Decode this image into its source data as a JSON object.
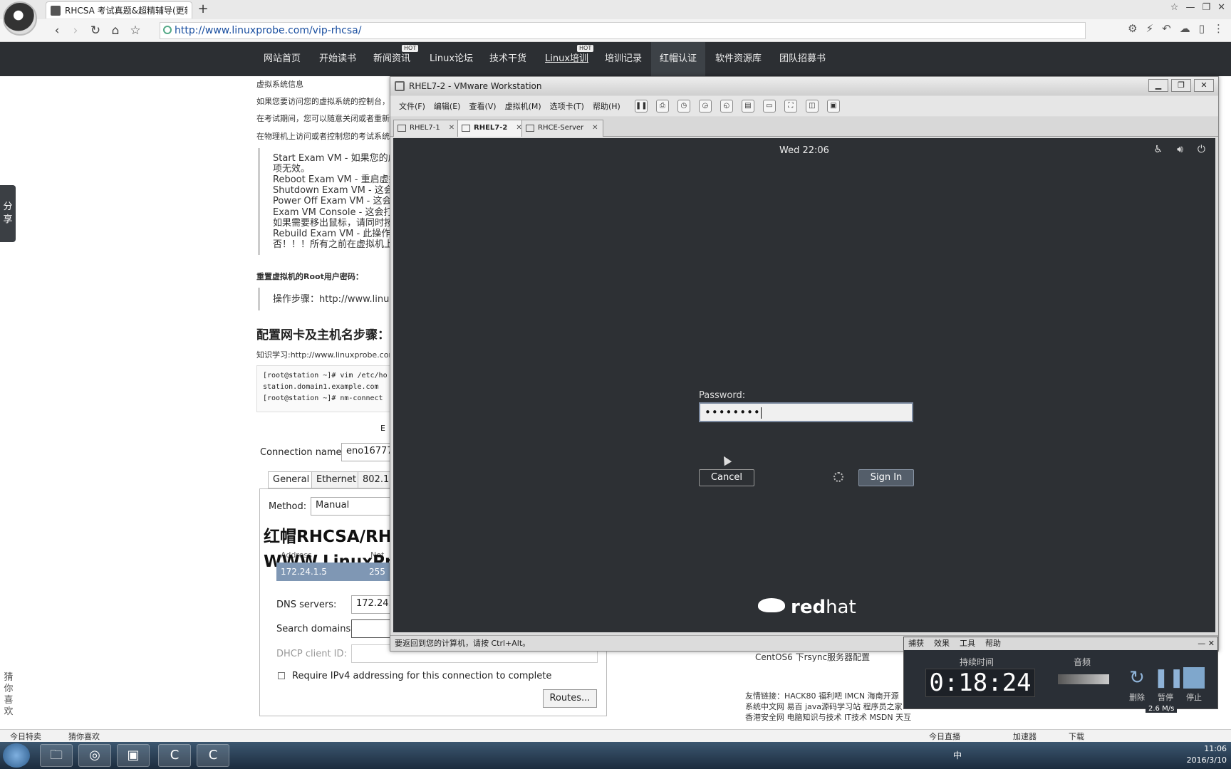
{
  "browser": {
    "tab_title": "RHCSA 考试真题&超精辅导(更新",
    "new_tab": "+",
    "url": "http://www.linuxprobe.com/vip-rhcsa/",
    "window_controls": [
      "☆",
      "—",
      "❐",
      "✕"
    ],
    "right_tools": [
      "⚙",
      "⚡",
      "↶",
      "☁",
      "▯",
      "⋮"
    ]
  },
  "site_nav": {
    "items": [
      "网站首页",
      "开始读书",
      "新闻资讯",
      "Linux论坛",
      "技术干货",
      "Linux培训",
      "培训记录",
      "红帽认证",
      "软件资源库",
      "团队招募书"
    ],
    "hot_badge": "HOT",
    "active": "红帽认证"
  },
  "page": {
    "share_label": "分享",
    "guess_label": "猜你喜欢",
    "section_title_small": "虚拟系统信息",
    "lines": [
      "如果您要访问您的虚拟系统的控制台，",
      "在考试期间，您可以随意关闭或者重新",
      "在物理机上访问或者控制您的考试系统"
    ],
    "quote_lines": [
      "Start Exam VM - 如果您的虚",
      "项无效。",
      "Reboot Exam VM - 重启虚拟",
      "Shutdown Exam VM - 这会",
      "Power Off Exam VM - 这会",
      "Exam VM Console - 这会打开",
      "如果需要移出鼠标，请同时按",
      "Rebuild Exam VM - 此操作将",
      "否！！！所有之前在虚拟机上"
    ],
    "root_pw_heading": "重置虚拟机的Root用户密码：",
    "steps_line": "操作步骤：http://www.linux",
    "net_heading": "配置网卡及主机名步骤：",
    "knowledge_line": "知识学习:http://www.linuxprobe.com",
    "code_lines": [
      "[root@station ~]# vim /etc/ho",
      "station.domain1.example.com",
      "[root@station ~]# nm-connect"
    ],
    "e_label": "E",
    "connection_name_label": "Connection name:",
    "connection_name_value": "eno16777",
    "tabs": [
      "General",
      "Ethernet",
      "802.1"
    ],
    "method_label": "Method:",
    "method_value": "Manual",
    "watermark1": "红帽RHCSA/RH",
    "watermark2": "WWW.LinuxPr",
    "address_header": "Address",
    "netmask_header": "Net",
    "address_value": "172.24.1.5",
    "netmask_value": "255",
    "dns_label": "DNS servers:",
    "dns_value": "172.24.",
    "search_label": "Search domains:",
    "dhcp_label": "DHCP client ID:",
    "require_ipv4": "Require IPv4 addressing for this connection to complete",
    "routes_button": "Routes...",
    "side_title": "CentOS6 下rsync服务器配置",
    "friend_links": [
      "友情链接：HACK80 福利吧 IMCN 海南开源",
      "系统中文网 易百 java源码学习站 程序员之家",
      "香港安全网 电脑知识与技术 IT技术 MSDN 天互"
    ]
  },
  "vmware": {
    "title": "RHEL7-2 - VMware Workstation",
    "menu": [
      "文件(F)",
      "编辑(E)",
      "查看(V)",
      "虚拟机(M)",
      "选项卡(T)",
      "帮助(H)"
    ],
    "tabs": [
      "RHEL7-1",
      "RHEL7-2",
      "RHCE-Server"
    ],
    "active_tab": "RHEL7-2",
    "status": "要返回到您的计算机，请按 Ctrl+Alt。"
  },
  "gdm": {
    "clock": "Wed 22:06",
    "password_label": "Password:",
    "password_dots": "••••••••",
    "cancel": "Cancel",
    "sign_in": "Sign In",
    "brand_bold": "red",
    "brand_light": "hat"
  },
  "recorder": {
    "menu": [
      "捕获",
      "效果",
      "工具",
      "帮助"
    ],
    "duration_label": "持续时间",
    "audio_label": "音频",
    "time": "0:18:24",
    "buttons": [
      "删除",
      "暂停",
      "停止"
    ],
    "rate": "2.6 M/s"
  },
  "bottom_bar": {
    "left": [
      "今日特卖",
      "猜你喜欢"
    ],
    "right": [
      "今日直播",
      "加速器",
      "下载"
    ]
  },
  "taskbar": {
    "time": "11:06",
    "date": "2016/3/10",
    "ime": "中"
  }
}
